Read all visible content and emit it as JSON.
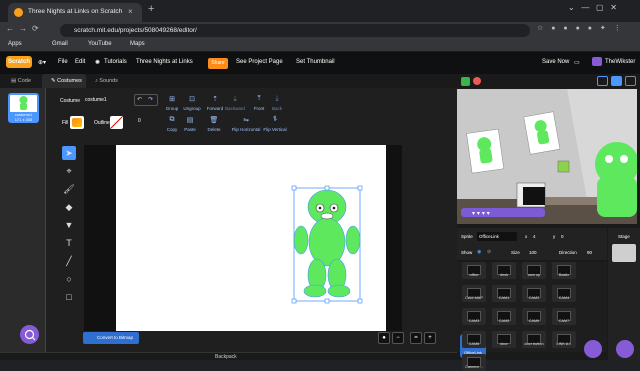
{
  "browser": {
    "tab_title": "Three Nights at Links on Scratch",
    "url": "scratch.mit.edu/projects/508049268/editor/",
    "bookmarks": [
      "Apps",
      "Gmail",
      "YouTube",
      "Maps"
    ]
  },
  "menu": {
    "logo": "Scratch",
    "file": "File",
    "edit": "Edit",
    "tutorials": "Tutorials",
    "project_title": "Three Nights at Links",
    "share": "Share",
    "see_project_page": "See Project Page",
    "set_thumbnail": "Set Thumbnail",
    "save_now": "Save Now",
    "username": "TheWikster"
  },
  "tabs": {
    "code": "Code",
    "costumes": "Costumes",
    "sounds": "Sounds"
  },
  "costume_list": {
    "name": "costume1",
    "size": "171 x 305"
  },
  "toolbar": {
    "costume_label": "Costume",
    "costume_name": "costume1",
    "fill_label": "Fill",
    "outline_label": "Outline",
    "outline_width": "0",
    "group": "Group",
    "ungroup": "Ungroup",
    "forward": "Forward",
    "backward": "Backward",
    "front": "Front",
    "back": "Back",
    "copy": "Copy",
    "paste": "Paste",
    "delete": "Delete",
    "flip_horizontal": "Flip Horizontal",
    "flip_vertical": "Flip Vertical"
  },
  "editor": {
    "convert_button": "Convert to Bitmap",
    "backpack": "Backpack"
  },
  "sprite_info": {
    "sprite_label": "Sprite",
    "sprite_name": "OfficeLink",
    "x_label": "x",
    "x_value": "4",
    "y_label": "y",
    "y_value": "0",
    "show_label": "Show",
    "size_label": "Size",
    "size_value": "100",
    "direction_label": "Direction",
    "direction_value": "90"
  },
  "stage_panel": {
    "label": "Stage"
  },
  "sprites": [
    {
      "name": "office"
    },
    {
      "name": "desk"
    },
    {
      "name": "cam up"
    },
    {
      "name": "Bastic"
    },
    {
      "name": "CAM MAP"
    },
    {
      "name": "CAM1"
    },
    {
      "name": "CAM2"
    },
    {
      "name": "CAM4"
    },
    {
      "name": "CAM3"
    },
    {
      "name": "CAM5"
    },
    {
      "name": "CAM6"
    },
    {
      "name": "CAM7"
    },
    {
      "name": "CAM8"
    },
    {
      "name": "door"
    },
    {
      "name": "door button"
    },
    {
      "name": "LINK A.I."
    },
    {
      "name": "Camera ..."
    }
  ],
  "selected_sprite": "OfficeLink",
  "colors": {
    "accent": "#4c97ff",
    "menubar": "#0f1011",
    "share": "#ff8c1a",
    "link_green": "#5de85d"
  }
}
